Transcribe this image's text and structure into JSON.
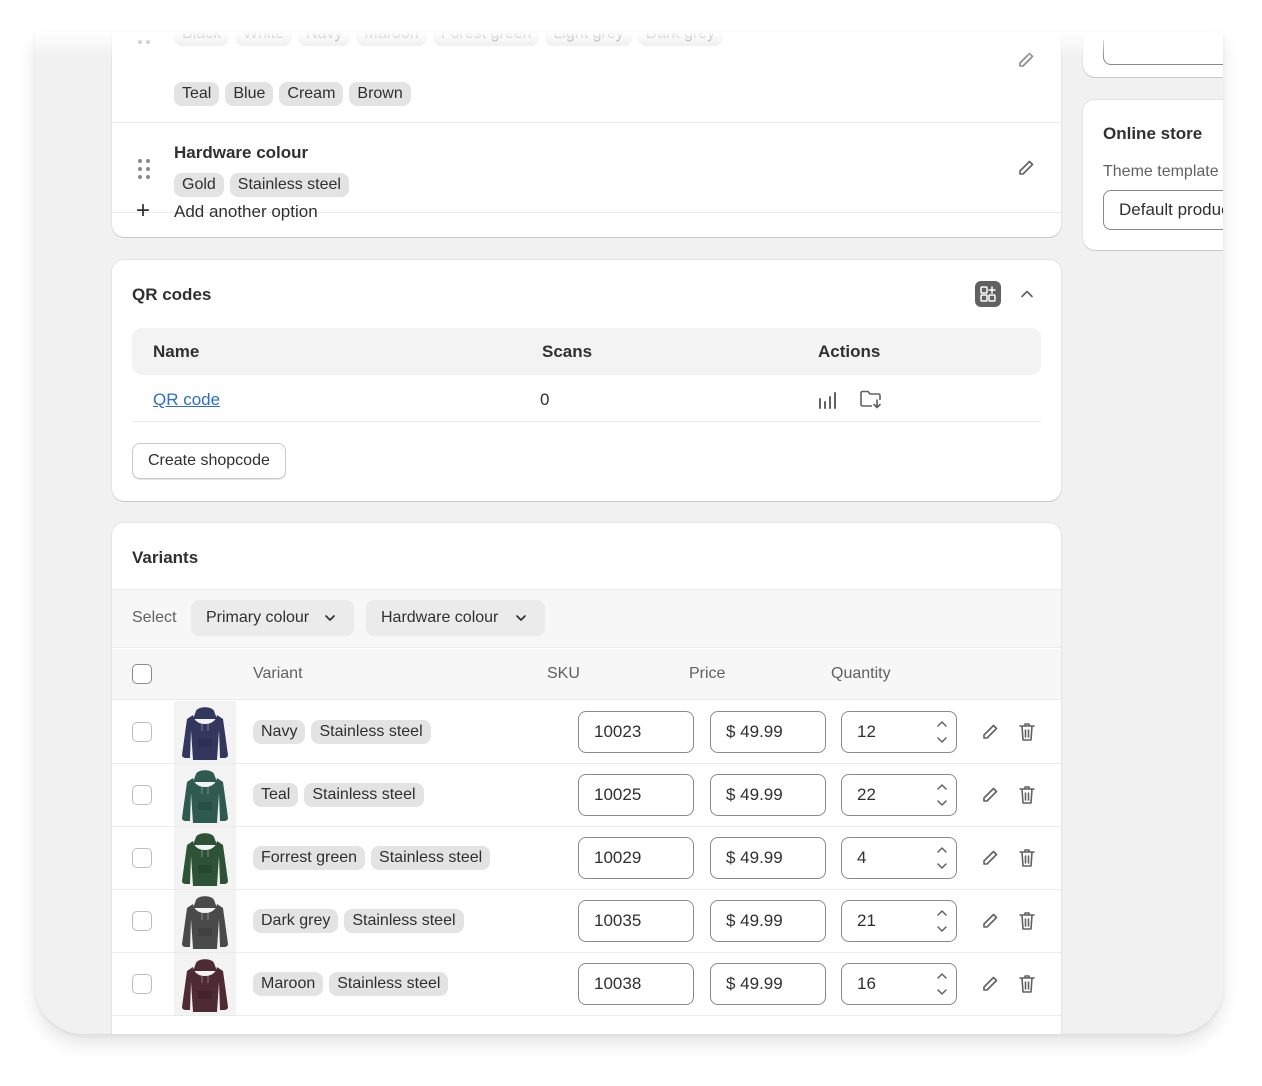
{
  "options": {
    "primary_colour_values_top": [
      "Black",
      "White",
      "Navy",
      "Maroon",
      "Forest green",
      "Light grey",
      "Dark grey"
    ],
    "primary_colour_values": [
      "Teal",
      "Blue",
      "Cream",
      "Brown"
    ],
    "hardware": {
      "title": "Hardware colour",
      "values": [
        "Gold",
        "Stainless steel"
      ]
    },
    "add_option_label": "Add another option"
  },
  "qr": {
    "title": "QR codes",
    "columns": [
      "Name",
      "Scans",
      "Actions"
    ],
    "rows": [
      {
        "name": "QR code",
        "scans": "0"
      }
    ],
    "create_button": "Create shopcode"
  },
  "variants": {
    "title": "Variants",
    "select_label": "Select",
    "filters": [
      "Primary colour",
      "Hardware colour"
    ],
    "columns": [
      "Variant",
      "SKU",
      "Price",
      "Quantity"
    ],
    "rows": [
      {
        "colour": "Navy",
        "hardware": "Stainless steel",
        "sku": "10023",
        "price": "$ 49.99",
        "quantity": "12",
        "swatch": "#33375e"
      },
      {
        "colour": "Teal",
        "hardware": "Stainless steel",
        "sku": "10025",
        "price": "$ 49.99",
        "quantity": "22",
        "swatch": "#2f5a4f"
      },
      {
        "colour": "Forrest green",
        "hardware": "Stainless steel",
        "sku": "10029",
        "price": "$ 49.99",
        "quantity": "4",
        "swatch": "#2e5235"
      },
      {
        "colour": "Dark grey",
        "hardware": "Stainless steel",
        "sku": "10035",
        "price": "$ 49.99",
        "quantity": "21",
        "swatch": "#4a4a4a"
      },
      {
        "colour": "Maroon",
        "hardware": "Stainless steel",
        "sku": "10038",
        "price": "$ 49.99",
        "quantity": "16",
        "swatch": "#4e2a33"
      }
    ]
  },
  "sidebar": {
    "online_store": {
      "title": "Online store",
      "template_label": "Theme template",
      "template_value": "Default product"
    }
  },
  "colors": {
    "link": "#2c6ecb",
    "page_bg": "#f1f1f1",
    "pill_bg": "#e3e3e3"
  }
}
